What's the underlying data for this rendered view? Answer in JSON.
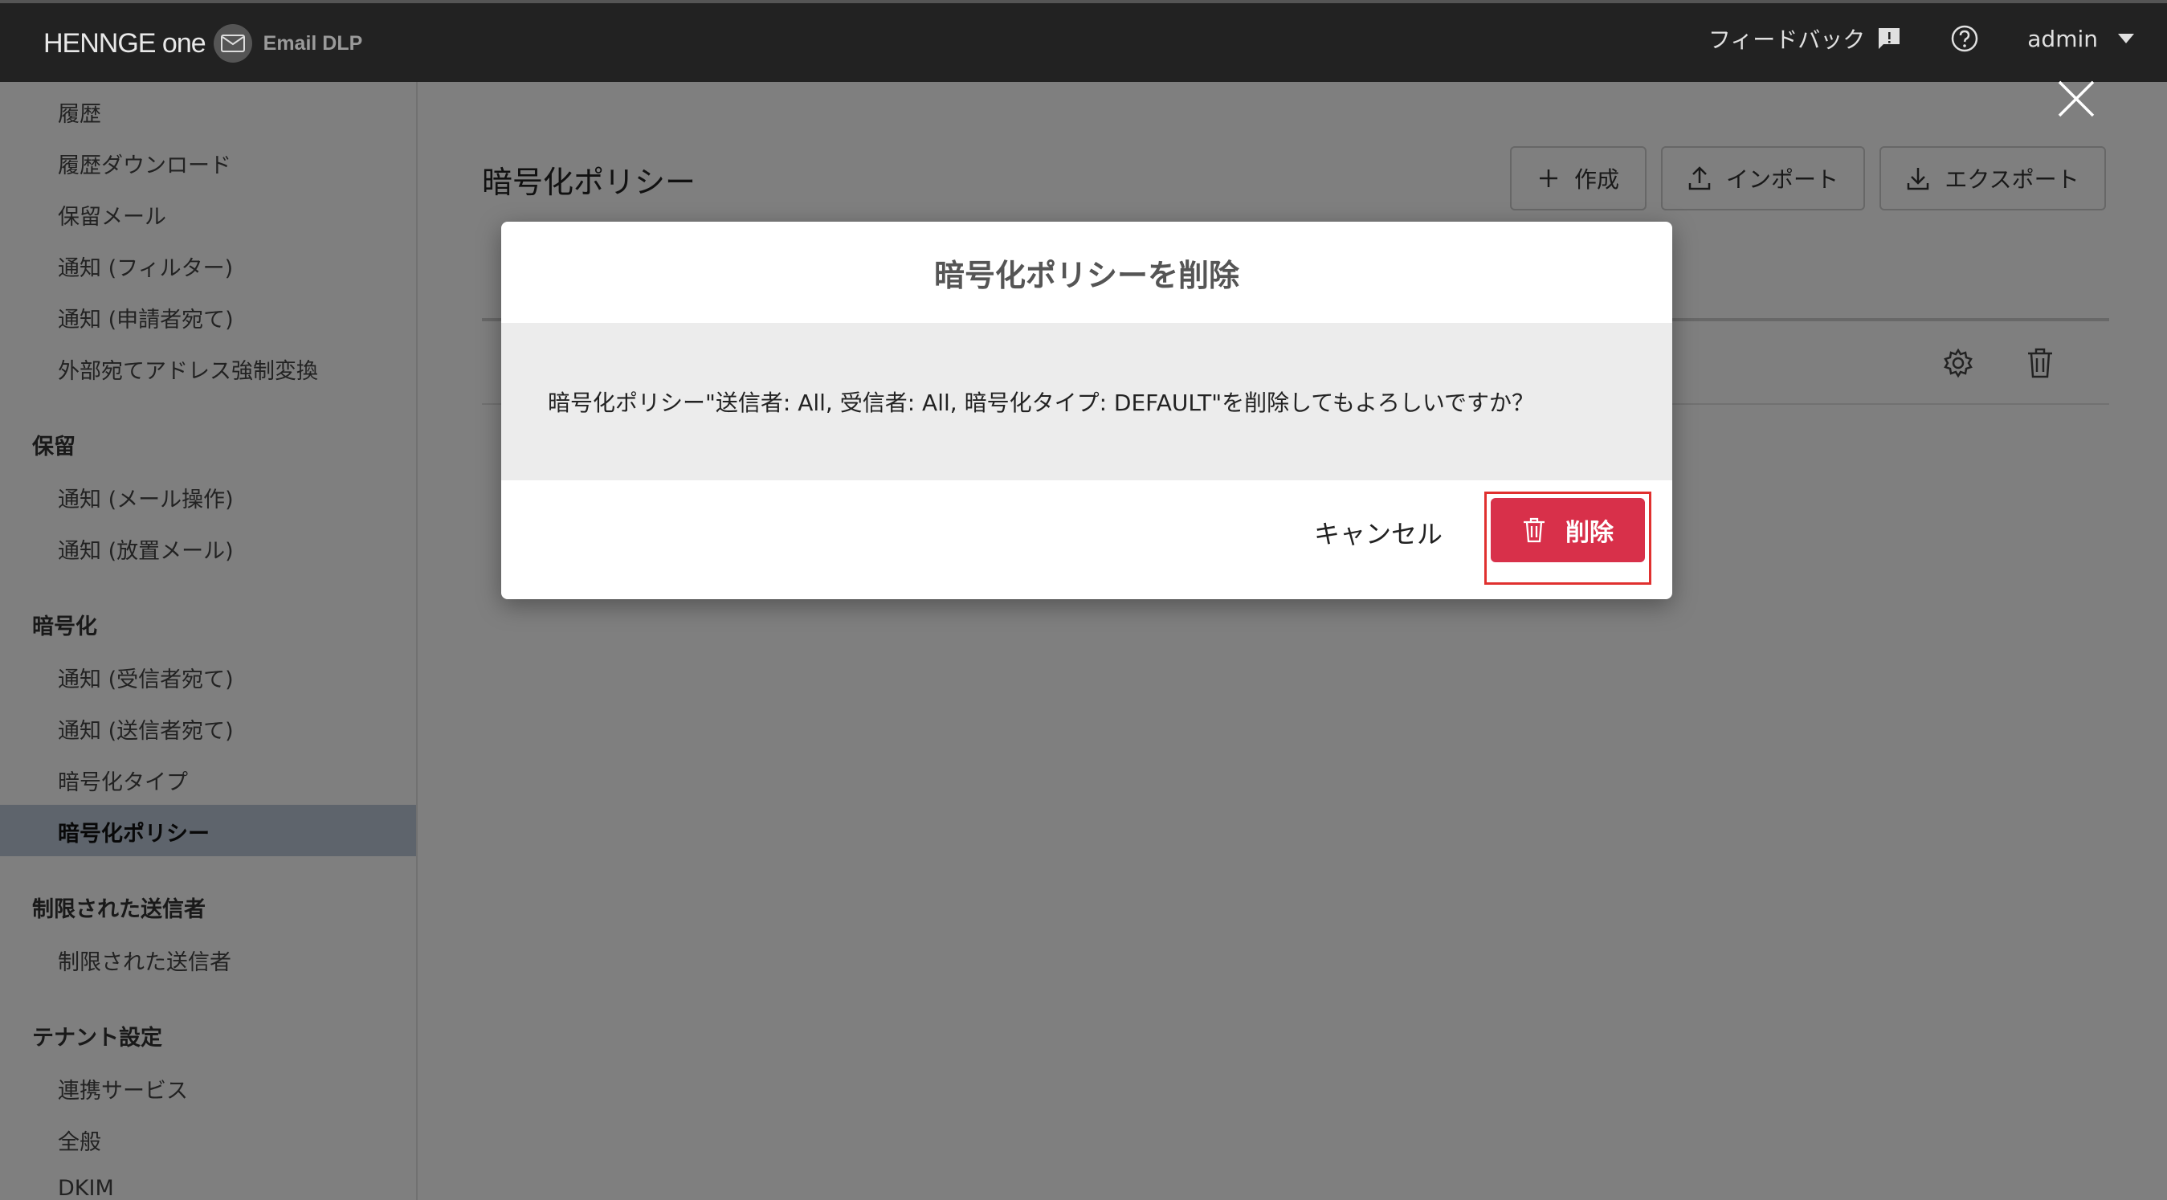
{
  "header": {
    "logo_text": "HENNGE one",
    "product": "Email DLP",
    "feedback_label": "フィードバック",
    "user_label": "admin"
  },
  "sidebar": {
    "items_top": [
      {
        "label": "履歴"
      },
      {
        "label": "履歴ダウンロード"
      },
      {
        "label": "保留メール"
      },
      {
        "label": "通知 (フィルター)"
      },
      {
        "label": "通知 (申請者宛て)"
      },
      {
        "label": "外部宛てアドレス強制変換"
      }
    ],
    "section_hold": "保留",
    "items_hold": [
      {
        "label": "通知 (メール操作)"
      },
      {
        "label": "通知 (放置メール)"
      }
    ],
    "section_encrypt": "暗号化",
    "items_encrypt": [
      {
        "label": "通知 (受信者宛て)"
      },
      {
        "label": "通知 (送信者宛て)"
      },
      {
        "label": "暗号化タイプ"
      },
      {
        "label": "暗号化ポリシー"
      }
    ],
    "section_restricted": "制限された送信者",
    "items_restricted": [
      {
        "label": "制限された送信者"
      }
    ],
    "section_tenant": "テナント設定",
    "items_tenant": [
      {
        "label": "連携サービス"
      },
      {
        "label": "全般"
      },
      {
        "label": "DKIM"
      }
    ]
  },
  "main": {
    "title": "暗号化ポリシー",
    "create_label": "作成",
    "import_label": "インポート",
    "export_label": "エクスポート"
  },
  "modal": {
    "title": "暗号化ポリシーを削除",
    "message": "暗号化ポリシー\"送信者: All, 受信者: All, 暗号化タイプ: DEFAULT\"を削除してもよろしいですか？",
    "cancel_label": "キャンセル",
    "delete_label": "削除"
  },
  "colors": {
    "topbar": "#222222",
    "danger": "#d8304a",
    "highlight": "#e0302f",
    "active_item": "#bcc9d8"
  }
}
